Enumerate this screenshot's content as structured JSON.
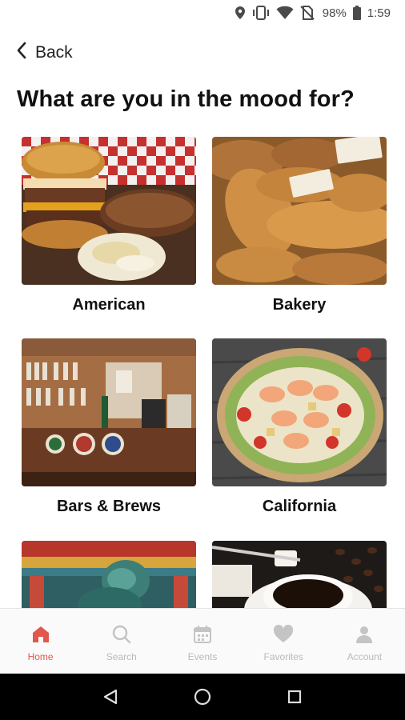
{
  "status_bar": {
    "battery": "98%",
    "time": "1:59",
    "icons": [
      "location-icon",
      "vibrate-icon",
      "wifi-icon",
      "no-sim-icon",
      "battery-icon"
    ]
  },
  "header": {
    "back_label": "Back",
    "title": "What are you in the mood for?"
  },
  "categories": [
    {
      "label": "American",
      "image": "burger-photo"
    },
    {
      "label": "Bakery",
      "image": "bread-photo"
    },
    {
      "label": "Bars & Brews",
      "image": "bar-photo"
    },
    {
      "label": "California",
      "image": "salad-photo"
    },
    {
      "label": "",
      "image": "asian-architecture-photo"
    },
    {
      "label": "",
      "image": "coffee-photo"
    }
  ],
  "bottom_nav": {
    "items": [
      {
        "label": "Home",
        "icon": "home-icon",
        "active": true
      },
      {
        "label": "Search",
        "icon": "search-icon",
        "active": false
      },
      {
        "label": "Events",
        "icon": "calendar-icon",
        "active": false
      },
      {
        "label": "Favorites",
        "icon": "heart-icon",
        "active": false
      },
      {
        "label": "Account",
        "icon": "person-icon",
        "active": false
      }
    ],
    "active_color": "#e2574c",
    "inactive_color": "#b9b9b9"
  },
  "system_nav": [
    "back-triangle-icon",
    "home-circle-icon",
    "recents-square-icon"
  ]
}
